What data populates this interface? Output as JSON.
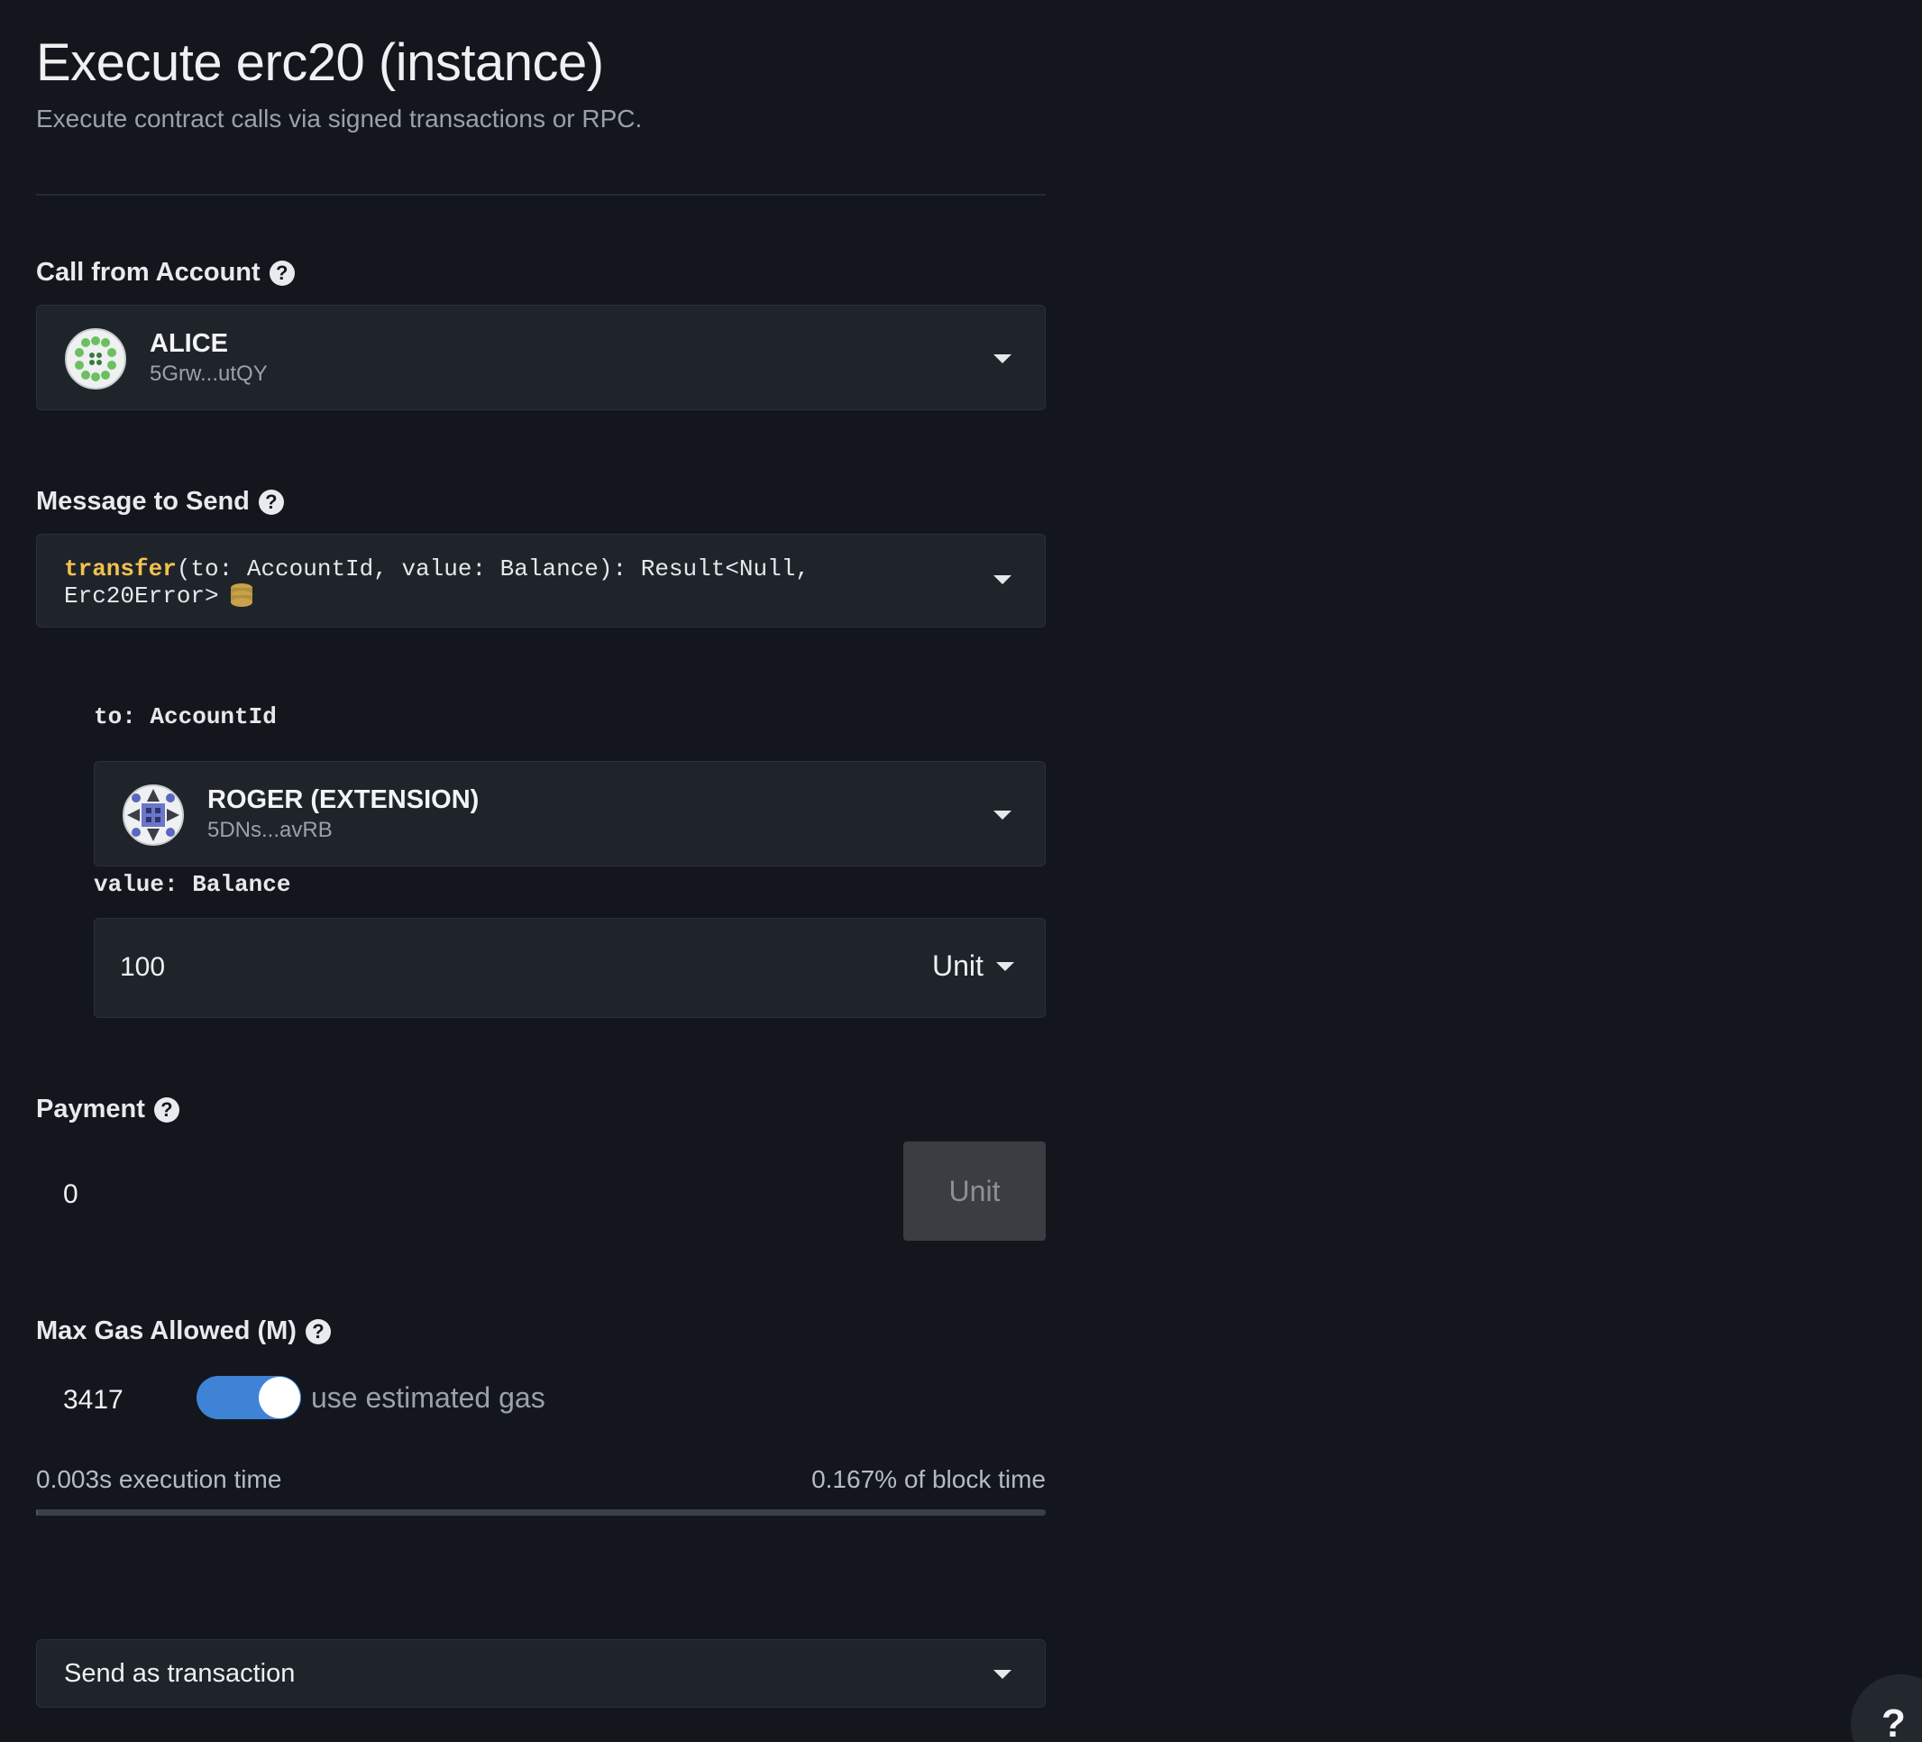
{
  "header": {
    "title": "Execute erc20 (instance)",
    "subtitle": "Execute contract calls via signed transactions or RPC."
  },
  "call_from": {
    "label": "Call from Account",
    "account_name": "ALICE",
    "account_address": "5Grw...utQY"
  },
  "message": {
    "label": "Message to Send",
    "fn_name": "transfer",
    "signature_line1": "(to: AccountId, value: Balance): Result<Null,",
    "signature_line2": "Erc20Error>",
    "badge_icon": "database-icon"
  },
  "params": {
    "to_label": "to: AccountId",
    "to_account_name": "ROGER (EXTENSION)",
    "to_account_address": "5DNs...avRB",
    "value_label": "value: Balance",
    "value": "100",
    "value_unit": "Unit"
  },
  "payment": {
    "label": "Payment",
    "value": "0",
    "unit": "Unit"
  },
  "gas": {
    "label": "Max Gas Allowed (M)",
    "value": "3417",
    "toggle_label": "use estimated gas",
    "toggle_on": true,
    "execution_time": "0.003s execution time",
    "block_time": "0.167% of block time",
    "block_time_fraction": 0.00167
  },
  "send": {
    "mode": "Send as transaction"
  },
  "help_fab": {
    "label": "?"
  },
  "colors": {
    "background": "#13171d",
    "panel": "#1f242b",
    "accent": "#3f83d6",
    "function_name": "#f2c14e"
  }
}
